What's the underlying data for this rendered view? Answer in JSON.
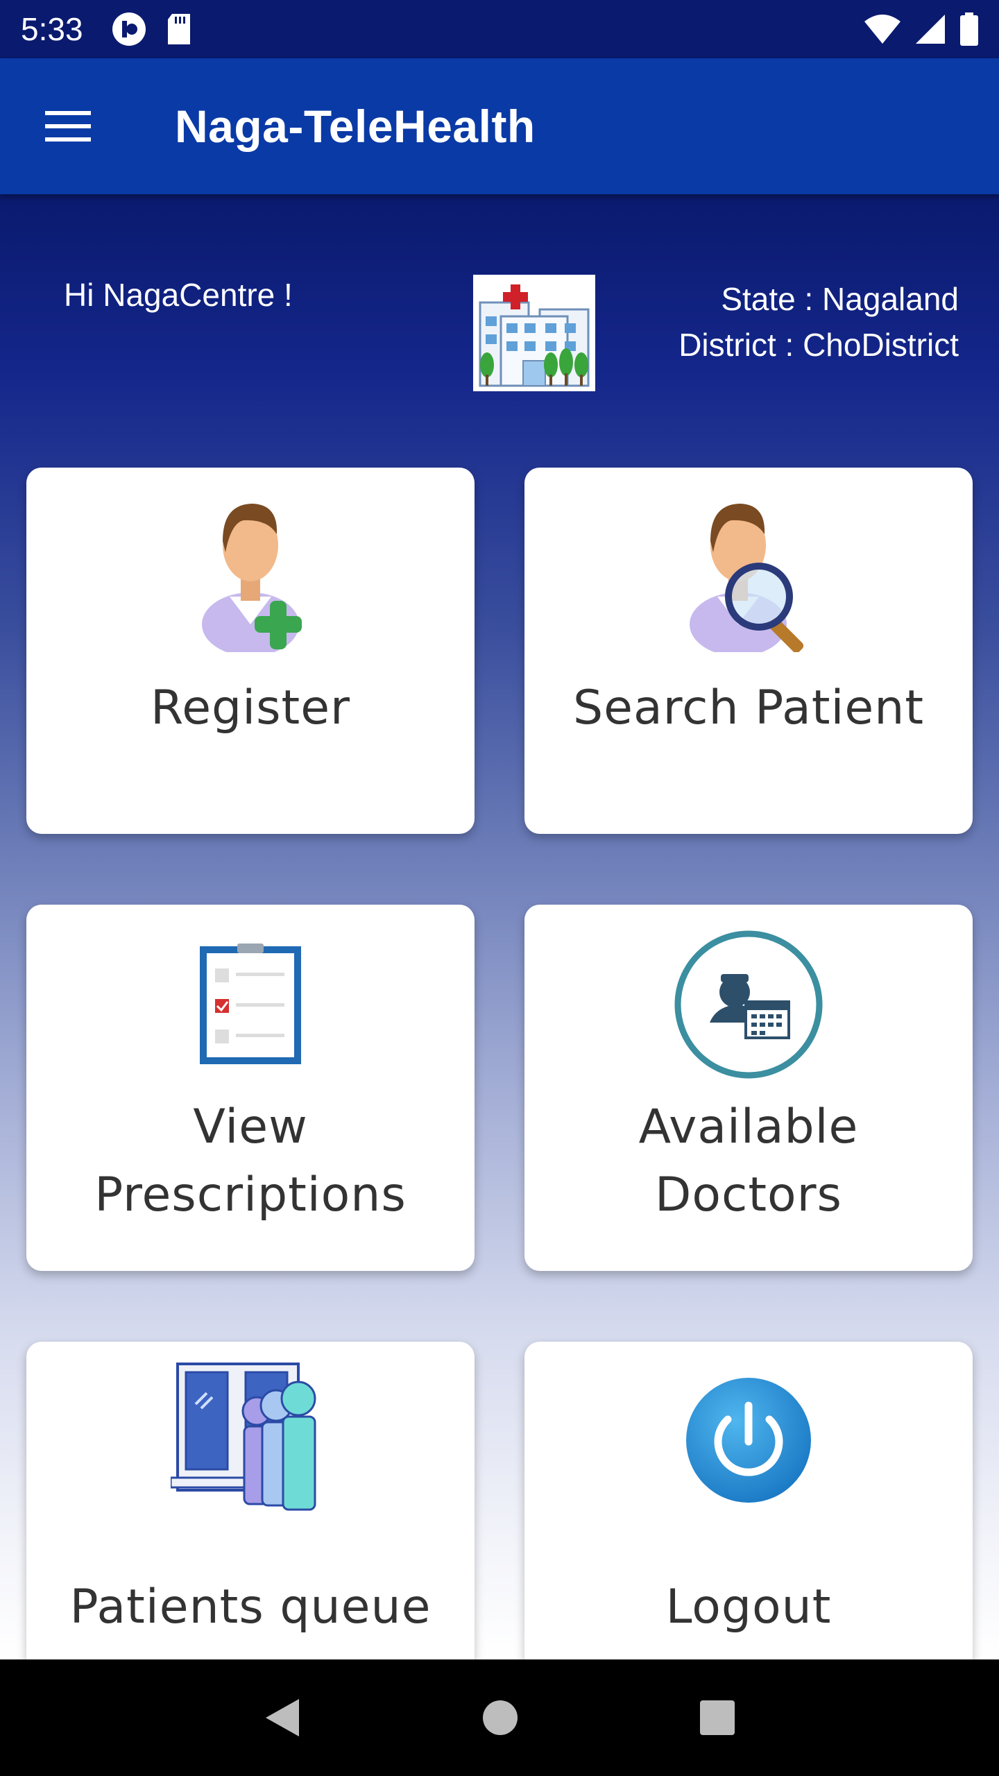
{
  "status_bar": {
    "time": "5:33"
  },
  "app_bar": {
    "title": "Naga-TeleHealth"
  },
  "header": {
    "greeting": "Hi NagaCentre !",
    "state": "State : Nagaland",
    "district": "District : ChoDistrict"
  },
  "cards": [
    {
      "label": "Register",
      "icon": "register-patient-icon"
    },
    {
      "label": "Search Patient",
      "icon": "search-patient-icon"
    },
    {
      "label_line1": "View",
      "label_line2": "Prescriptions",
      "icon": "prescription-clipboard-icon"
    },
    {
      "label_line1": "Available",
      "label_line2": "Doctors",
      "icon": "doctor-calendar-icon"
    },
    {
      "label": "Patients queue",
      "icon": "patients-queue-icon"
    },
    {
      "label": "Logout",
      "icon": "power-icon"
    }
  ],
  "colors": {
    "status_bar": "#0a1a6e",
    "app_bar": "#0a3aa6",
    "card_text": "#333333"
  }
}
